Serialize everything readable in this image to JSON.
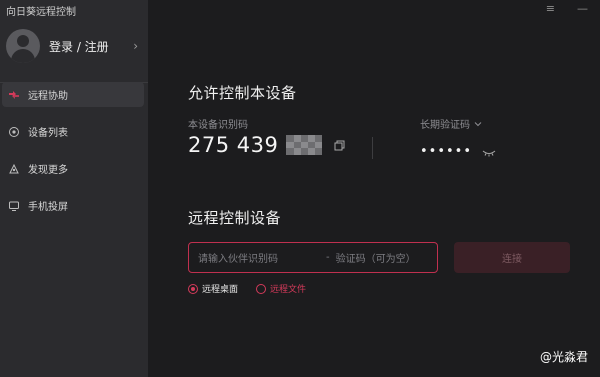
{
  "app": {
    "title": "向日葵远程控制"
  },
  "profile": {
    "login_label": "登录 / 注册"
  },
  "sidebar": {
    "items": [
      {
        "label": "远程协助",
        "icon": "remote-assist-icon",
        "active": true
      },
      {
        "label": "设备列表",
        "icon": "device-list-icon",
        "active": false
      },
      {
        "label": "发现更多",
        "icon": "discover-icon",
        "active": false
      },
      {
        "label": "手机投屏",
        "icon": "screen-cast-icon",
        "active": false
      }
    ]
  },
  "allow": {
    "title": "允许控制本设备",
    "id_label": "本设备识别码",
    "id_value": "275 439",
    "code_label": "长期验证码",
    "code_value": "••••••"
  },
  "remote": {
    "title": "远程控制设备",
    "partner_placeholder": "请输入伙伴识别码",
    "separator": "-",
    "code_placeholder": "验证码（可为空）",
    "connect_label": "连接",
    "options": [
      {
        "label": "远程桌面",
        "selected": true
      },
      {
        "label": "远程文件",
        "selected": false
      }
    ]
  },
  "watermark": {
    "text": "@光淼君"
  },
  "colors": {
    "accent": "#d33a5a",
    "sidebar_bg": "#2b2b2e",
    "main_bg": "#1c1c1e"
  }
}
